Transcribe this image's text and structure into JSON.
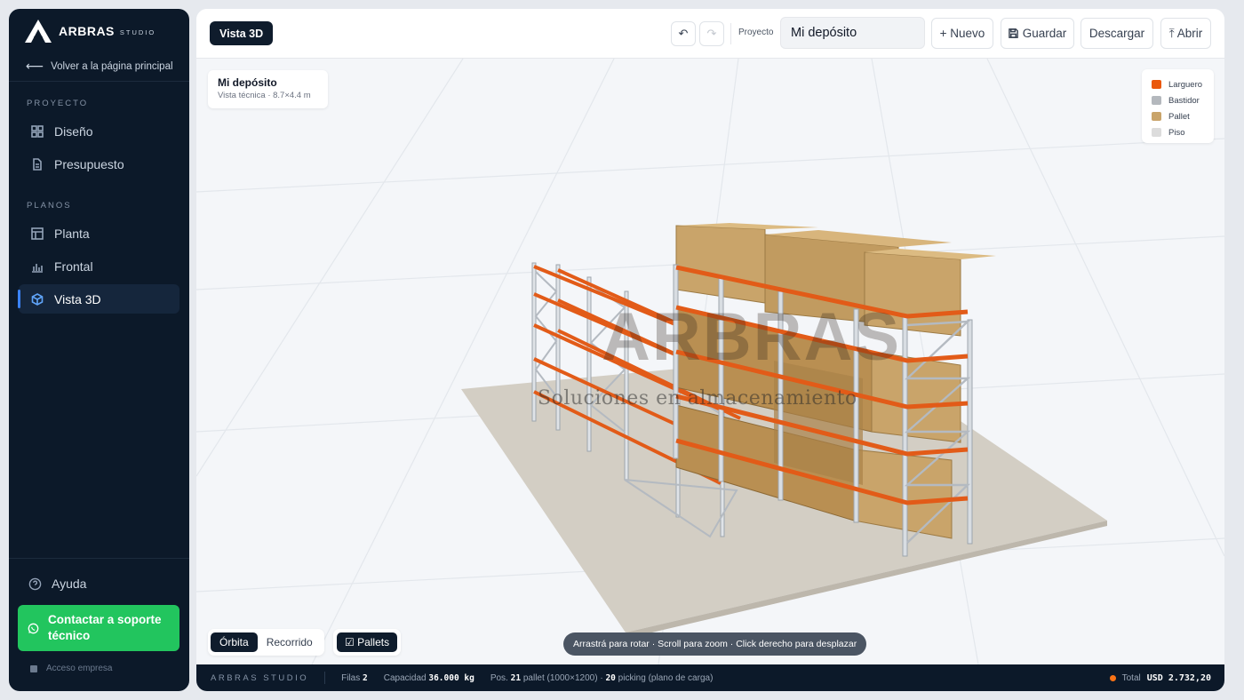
{
  "brand": {
    "name": "ARBRAS",
    "sub": "STUDIO"
  },
  "sidebar": {
    "back_label": "Volver a la página principal",
    "sections": {
      "proyecto": "PROYECTO",
      "planos": "PLANOS"
    },
    "items": {
      "diseno": "Diseño",
      "presupuesto": "Presupuesto",
      "planta": "Planta",
      "frontal": "Frontal",
      "vista3d": "Vista 3D"
    },
    "help": "Ayuda",
    "support": "Contactar a soporte técnico",
    "acceso": "Acceso empresa"
  },
  "topbar": {
    "view_badge": "Vista 3D",
    "undo_icon": "↶",
    "redo_icon": "↷",
    "project_label": "Proyecto",
    "project_name": "Mi depósito",
    "nuevo": "+ Nuevo",
    "guardar": "Guardar",
    "descargar": "Descargar",
    "abrir": "⤒ Abrir"
  },
  "info": {
    "title": "Mi depósito",
    "subtitle": "Vista técnica · 8.7×4.4 m"
  },
  "legend": [
    {
      "label": "Larguero",
      "color": "#ea580c"
    },
    {
      "label": "Bastidor",
      "color": "#b4b8bd"
    },
    {
      "label": "Pallet",
      "color": "#c9a46a"
    },
    {
      "label": "Piso",
      "color": "#dcdcdc"
    }
  ],
  "watermark": {
    "logo": "ARBRAS",
    "text": "Soluciones en almacenamiento"
  },
  "controls": {
    "orbita": "Órbita",
    "recorrido": "Recorrido",
    "pallets": "☑ Pallets"
  },
  "hint": "Arrastrá para rotar · Scroll para zoom · Click derecho para desplazar",
  "status": {
    "brand": "ARBRAS STUDIO",
    "filas_label": "Filas",
    "filas_value": "2",
    "capacidad_label": "Capacidad",
    "capacidad_value": "36.000 kg",
    "pos_label": "Pos.",
    "pos_pallet_value": "21",
    "pos_pallet_text": "pallet (1000×1200) ·",
    "pos_picking_value": "20",
    "pos_picking_text": "picking (plano de carga)",
    "total_label": "Total",
    "total_value": "USD 2.732,20"
  },
  "colors": {
    "accent": "#3b82f6",
    "support": "#22c55e",
    "larguero": "#ea580c",
    "pallet": "#c9a46a"
  }
}
